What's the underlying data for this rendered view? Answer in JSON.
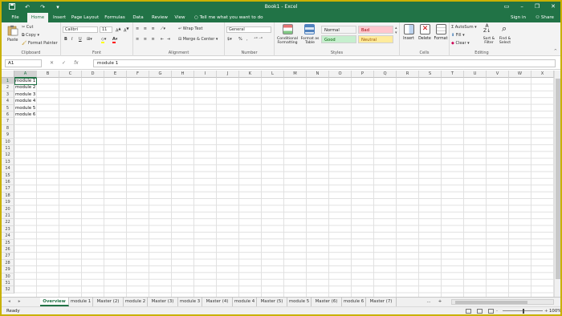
{
  "app": {
    "title": "Book1 - Excel",
    "accent": "#217346",
    "qat_icons": [
      "save-icon",
      "undo-icon",
      "redo-icon",
      "customize-qat-icon"
    ],
    "window_controls": [
      "minimize-icon",
      "restore-icon",
      "close-icon"
    ]
  },
  "menu": {
    "tabs": [
      "File",
      "Home",
      "Insert",
      "Page Layout",
      "Formulas",
      "Data",
      "Review",
      "View"
    ],
    "active_tab": "Home",
    "tell_me": "Tell me what you want to do",
    "sign_in": "Sign in",
    "share": "Share"
  },
  "ribbon": {
    "clipboard": {
      "label": "Clipboard",
      "paste": "Paste",
      "cut": "Cut",
      "copy": "Copy",
      "format_painter": "Format Painter"
    },
    "font": {
      "label": "Font",
      "font_name": "Calibri",
      "font_size": "11",
      "bold": "B",
      "italic": "I",
      "underline": "U"
    },
    "alignment": {
      "label": "Alignment",
      "wrap_text": "Wrap Text",
      "merge_center": "Merge & Center"
    },
    "number": {
      "label": "Number",
      "format": "General",
      "currency": "$",
      "percent": "%",
      "comma": ","
    },
    "styles": {
      "label": "Styles",
      "conditional_formatting": "Conditional Formatting",
      "format_as_table": "Format as Table",
      "cells": [
        {
          "name": "Normal",
          "bg": "#ffffff",
          "color": "#000000"
        },
        {
          "name": "Bad",
          "bg": "#ffc7ce",
          "color": "#9c0006"
        },
        {
          "name": "Good",
          "bg": "#c6efce",
          "color": "#006100"
        },
        {
          "name": "Neutral",
          "bg": "#ffeb9c",
          "color": "#9c5700"
        }
      ]
    },
    "cells": {
      "label": "Cells",
      "insert": "Insert",
      "delete": "Delete",
      "format": "Format"
    },
    "editing": {
      "label": "Editing",
      "autosum": "AutoSum",
      "fill": "Fill",
      "clear": "Clear",
      "sort_filter": "Sort & Filter",
      "find_select": "Find & Select"
    }
  },
  "formula_bar": {
    "name_box": "A1",
    "fx": "fx",
    "value": "module 1"
  },
  "grid": {
    "columns": [
      "A",
      "B",
      "C",
      "D",
      "E",
      "F",
      "G",
      "H",
      "I",
      "J",
      "K",
      "L",
      "M",
      "N",
      "O",
      "P",
      "Q",
      "R",
      "S",
      "T",
      "U",
      "V",
      "W",
      "X"
    ],
    "row_count": 32,
    "selected_cell": "A1",
    "cells": [
      {
        "ref": "A1",
        "value": "module 1"
      },
      {
        "ref": "A2",
        "value": "module 2"
      },
      {
        "ref": "A3",
        "value": "module 3"
      },
      {
        "ref": "A4",
        "value": "module 4"
      },
      {
        "ref": "A5",
        "value": "module 5"
      },
      {
        "ref": "A6",
        "value": "module 6"
      }
    ]
  },
  "sheets": {
    "tabs": [
      "Overview",
      "module 1",
      "Master (2)",
      "module 2",
      "Master (3)",
      "module 3",
      "Master (4)",
      "module 4",
      "Master (5)",
      "module 5",
      "Master (6)",
      "module 6",
      "Master (7)"
    ],
    "active": "Overview",
    "more": "...",
    "add": "+"
  },
  "status": {
    "text": "Ready",
    "zoom": "100%",
    "zoom_out": "-",
    "zoom_in": "+"
  }
}
